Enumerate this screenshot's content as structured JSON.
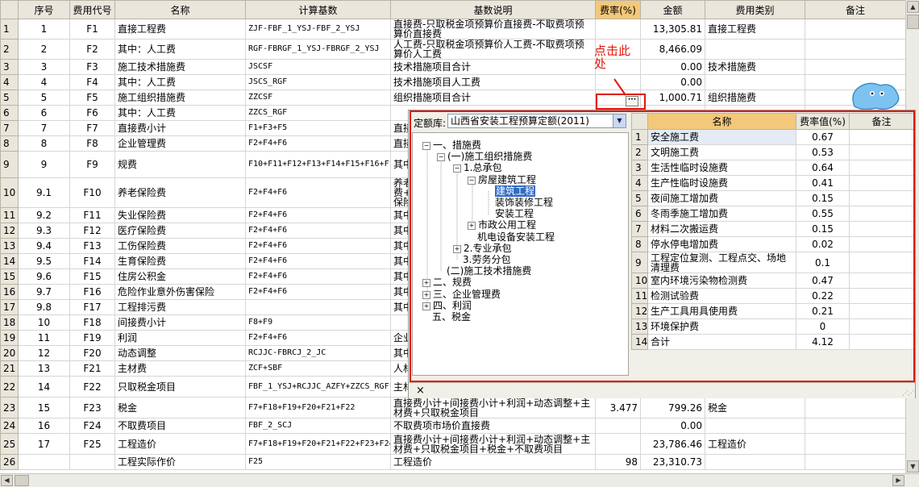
{
  "main_grid": {
    "headers": [
      "",
      "序号",
      "费用代号",
      "名称",
      "计算基数",
      "基数说明",
      "费率(%)",
      "金额",
      "费用类别",
      "备注"
    ],
    "rows": [
      {
        "rn": "1",
        "seq": "1",
        "code": "F1",
        "name": "直接工程费",
        "base": "ZJF-FBF_1_YSJ-FBF_2_YSJ",
        "desc": "直接费-只取税金项预算价直接费-不取费项预算价直接费",
        "rate": "",
        "amount": "13,305.81",
        "category": "直接工程费",
        "note": ""
      },
      {
        "rn": "2",
        "seq": "2",
        "code": "F2",
        "name": "其中：人工费",
        "base": "RGF-FBRGF_1_YSJ-FBRGF_2_YSJ",
        "desc": "人工费-只取税金项预算价人工费-不取费项预算价人工费",
        "rate": "",
        "amount": "8,466.09",
        "category": "",
        "note": ""
      },
      {
        "rn": "3",
        "seq": "3",
        "code": "F3",
        "name": "施工技术措施费",
        "base": "JSCSF",
        "desc": "技术措施项目合计",
        "rate": "",
        "amount": "0.00",
        "category": "技术措施费",
        "note": ""
      },
      {
        "rn": "4",
        "seq": "4",
        "code": "F4",
        "name": "其中：人工费",
        "base": "JSCS_RGF",
        "desc": "技术措施项目人工费",
        "rate": "",
        "amount": "0.00",
        "category": "",
        "note": ""
      },
      {
        "rn": "5",
        "seq": "5",
        "code": "F5",
        "name": "施工组织措施费",
        "base": "ZZCSF",
        "desc": "组织措施项目合计",
        "rate": "",
        "amount": "1,000.71",
        "category": "组织措施费",
        "note": ""
      },
      {
        "rn": "6",
        "seq": "6",
        "code": "F6",
        "name": "其中：人工费",
        "base": "ZZCS_RGF",
        "desc": "",
        "rate": "",
        "amount": "",
        "category": "",
        "note": ""
      },
      {
        "rn": "7",
        "seq": "7",
        "code": "F7",
        "name": "直接费小计",
        "base": "F1+F3+F5",
        "desc": "",
        "rate": "",
        "amount": "",
        "category": "",
        "note": ""
      },
      {
        "rn": "8",
        "seq": "8",
        "code": "F8",
        "name": "企业管理费",
        "base": "F2+F4+F6",
        "desc": "",
        "rate": "",
        "amount": "",
        "category": "",
        "note": ""
      },
      {
        "rn": "9",
        "seq": "9",
        "code": "F9",
        "name": "规费",
        "base": "F10+F11+F12+F13+F14+F15+F16+F17",
        "desc": "",
        "rate": "",
        "amount": "",
        "category": "",
        "note": ""
      },
      {
        "rn": "10",
        "seq": "9.1",
        "code": "F10",
        "name": "养老保险费",
        "base": "F2+F4+F6",
        "desc": "",
        "rate": "",
        "amount": "",
        "category": "",
        "note": ""
      },
      {
        "rn": "11",
        "seq": "9.2",
        "code": "F11",
        "name": "失业保险费",
        "base": "F2+F4+F6",
        "desc": "",
        "rate": "",
        "amount": "",
        "category": "",
        "note": ""
      },
      {
        "rn": "12",
        "seq": "9.3",
        "code": "F12",
        "name": "医疗保险费",
        "base": "F2+F4+F6",
        "desc": "",
        "rate": "",
        "amount": "",
        "category": "",
        "note": ""
      },
      {
        "rn": "13",
        "seq": "9.4",
        "code": "F13",
        "name": "工伤保险费",
        "base": "F2+F4+F6",
        "desc": "",
        "rate": "",
        "amount": "",
        "category": "",
        "note": ""
      },
      {
        "rn": "14",
        "seq": "9.5",
        "code": "F14",
        "name": "生育保险费",
        "base": "F2+F4+F6",
        "desc": "",
        "rate": "",
        "amount": "",
        "category": "",
        "note": ""
      },
      {
        "rn": "15",
        "seq": "9.6",
        "code": "F15",
        "name": "住房公积金",
        "base": "F2+F4+F6",
        "desc": "",
        "rate": "",
        "amount": "",
        "category": "",
        "note": ""
      },
      {
        "rn": "16",
        "seq": "9.7",
        "code": "F16",
        "name": "危险作业意外伤害保险",
        "base": "F2+F4+F6",
        "desc": "",
        "rate": "",
        "amount": "",
        "category": "",
        "note": ""
      },
      {
        "rn": "17",
        "seq": "9.8",
        "code": "F17",
        "name": "工程排污费",
        "base": "",
        "desc": "",
        "rate": "",
        "amount": "",
        "category": "",
        "note": ""
      },
      {
        "rn": "18",
        "seq": "10",
        "code": "F18",
        "name": "间接费小计",
        "base": "F8+F9",
        "desc": "",
        "rate": "",
        "amount": "",
        "category": "",
        "note": ""
      },
      {
        "rn": "19",
        "seq": "11",
        "code": "F19",
        "name": "利润",
        "base": "F2+F4+F6",
        "desc": "",
        "rate": "",
        "amount": "",
        "category": "",
        "note": ""
      },
      {
        "rn": "20",
        "seq": "12",
        "code": "F20",
        "name": "动态调整",
        "base": "RCJJC-FBRCJ_2_JC",
        "desc": "",
        "rate": "",
        "amount": "",
        "category": "",
        "note": ""
      },
      {
        "rn": "21",
        "seq": "13",
        "code": "F21",
        "name": "主材费",
        "base": "ZCF+SBF",
        "desc": "",
        "rate": "",
        "amount": "",
        "category": "",
        "note": ""
      },
      {
        "rn": "22",
        "seq": "14",
        "code": "F22",
        "name": "只取税金项目",
        "base": "FBF_1_YSJ+RCJJC_AZFY+ZZCS_RGF*0.2281",
        "desc": "",
        "rate": "",
        "amount": "",
        "category": "",
        "note": ""
      },
      {
        "rn": "23",
        "seq": "15",
        "code": "F23",
        "name": "税金",
        "base": "F7+F18+F19+F20+F21+F22",
        "desc": "直接费小计+间接费小计+利润+动态调整+主材费+只取税金项目",
        "rate": "3.477",
        "amount": "799.26",
        "category": "税金",
        "note": ""
      },
      {
        "rn": "24",
        "seq": "16",
        "code": "F24",
        "name": "不取费项目",
        "base": "FBF_2_SCJ",
        "desc": "不取费项市场价直接费",
        "rate": "",
        "amount": "0.00",
        "category": "",
        "note": ""
      },
      {
        "rn": "25",
        "seq": "17",
        "code": "F25",
        "name": "工程造价",
        "base": "F7+F18+F19+F20+F21+F22+F23+F24",
        "desc": "直接费小计+间接费小计+利润+动态调整+主材费+只取税金项目+税金+不取费项目",
        "rate": "",
        "amount": "23,786.46",
        "category": "工程造价",
        "note": ""
      },
      {
        "rn": "26",
        "seq": "",
        "code": "",
        "name": "工程实际作价",
        "base": "F25",
        "desc": "工程造价",
        "rate": "98",
        "amount": "23,310.73",
        "category": "",
        "note": ""
      }
    ],
    "partial_desc": {
      "6": "直接",
      "7": "直接",
      "8": "其中",
      "9": "养老\n费+生\n保险",
      "10": "其中",
      "11": "其中",
      "12": "其中",
      "13": "其中",
      "14": "其中",
      "15": "其中",
      "16": "其中",
      "17": "",
      "18": "企业",
      "19": "其中",
      "20": "人材",
      "21": "主材",
      "22": "只取\n+组织"
    }
  },
  "annotation": {
    "hint_text": "点击此处",
    "ellipsis_label": "···"
  },
  "popup": {
    "library_label": "定额库:",
    "library_value": "山西省安装工程预算定额(2011)",
    "tree": [
      {
        "label": "一、措施费",
        "depth": 0,
        "toggle": "−"
      },
      {
        "label": "(一)施工组织措施费",
        "depth": 1,
        "toggle": "−"
      },
      {
        "label": "1.总承包",
        "depth": 2,
        "toggle": "−"
      },
      {
        "label": "房屋建筑工程",
        "depth": 3,
        "toggle": "−"
      },
      {
        "label": "建筑工程",
        "depth": 4,
        "toggle": "",
        "selected": true
      },
      {
        "label": "装饰装修工程",
        "depth": 4,
        "toggle": ""
      },
      {
        "label": "安装工程",
        "depth": 4,
        "toggle": ""
      },
      {
        "label": "市政公用工程",
        "depth": 3,
        "toggle": "+"
      },
      {
        "label": "机电设备安装工程",
        "depth": 3,
        "toggle": ""
      },
      {
        "label": "2.专业承包",
        "depth": 2,
        "toggle": "+"
      },
      {
        "label": "3.劳务分包",
        "depth": 2,
        "toggle": ""
      },
      {
        "label": "(二)施工技术措施费",
        "depth": 1,
        "toggle": ""
      },
      {
        "label": "二、规费",
        "depth": 0,
        "toggle": "+"
      },
      {
        "label": "三、企业管理费",
        "depth": 0,
        "toggle": "+"
      },
      {
        "label": "四、利润",
        "depth": 0,
        "toggle": "+"
      },
      {
        "label": "五、税金",
        "depth": 0,
        "toggle": ""
      }
    ],
    "rate_headers": [
      "",
      "名称",
      "费率值(%)",
      "备注"
    ],
    "rates": [
      {
        "rn": "1",
        "name": "安全施工费",
        "value": "0.67"
      },
      {
        "rn": "2",
        "name": "文明施工费",
        "value": "0.53"
      },
      {
        "rn": "3",
        "name": "生活性临时设施费",
        "value": "0.64"
      },
      {
        "rn": "4",
        "name": "生产性临时设施费",
        "value": "0.41"
      },
      {
        "rn": "5",
        "name": "夜间施工增加费",
        "value": "0.15"
      },
      {
        "rn": "6",
        "name": "冬雨季施工增加费",
        "value": "0.55"
      },
      {
        "rn": "7",
        "name": "材料二次搬运费",
        "value": "0.15"
      },
      {
        "rn": "8",
        "name": "停水停电增加费",
        "value": "0.02"
      },
      {
        "rn": "9",
        "name": "工程定位复测、工程点交、场地清理费",
        "value": "0.1"
      },
      {
        "rn": "10",
        "name": "室内环境污染物检测费",
        "value": "0.47"
      },
      {
        "rn": "11",
        "name": "检测试验费",
        "value": "0.22"
      },
      {
        "rn": "12",
        "name": "生产工具用具使用费",
        "value": "0.21"
      },
      {
        "rn": "13",
        "name": "环境保护费",
        "value": "0"
      },
      {
        "rn": "14",
        "name": "合计",
        "value": "4.12"
      }
    ],
    "close_glyph": "×"
  },
  "colors": {
    "accent_red": "#e0180e",
    "selection": "#316ac5",
    "header_highlight": "#f3c87a"
  }
}
